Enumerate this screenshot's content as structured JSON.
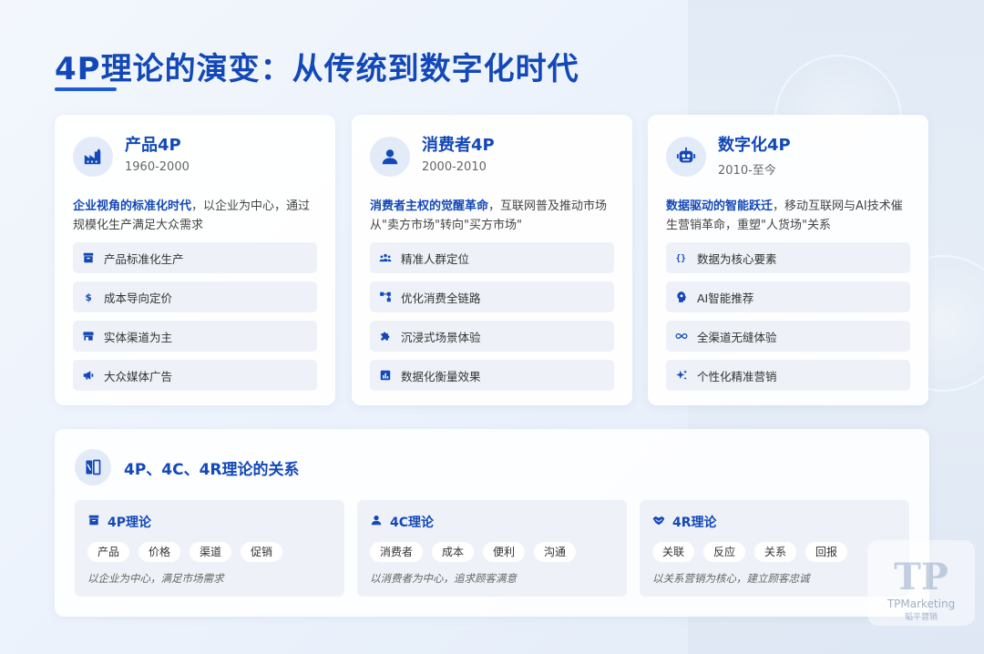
{
  "page": {
    "title": "4P理论的演变：从传统到数字化时代"
  },
  "cards": [
    {
      "title": "产品4P",
      "years": "1960-2000",
      "icon": "factory-icon",
      "desc_highlight": "企业视角的标准化时代",
      "desc_rest": "，以企业为中心，通过规模化生产满足大众需求",
      "features": [
        {
          "icon": "archive-icon",
          "label": "产品标准化生产"
        },
        {
          "icon": "dollar-icon",
          "label": "成本导向定价"
        },
        {
          "icon": "store-icon",
          "label": "实体渠道为主"
        },
        {
          "icon": "megaphone-icon",
          "label": "大众媒体广告"
        }
      ]
    },
    {
      "title": "消费者4P",
      "years": "2000-2010",
      "icon": "person-icon",
      "desc_highlight": "消费者主权的觉醒革命",
      "desc_rest": "，互联网普及推动市场从\"卖方市场\"转向\"买方市场\"",
      "features": [
        {
          "icon": "people-group-icon",
          "label": "精准人群定位"
        },
        {
          "icon": "flow-icon",
          "label": "优化消费全链路"
        },
        {
          "icon": "puzzle-icon",
          "label": "沉浸式场景体验"
        },
        {
          "icon": "bar-chart-icon",
          "label": "数据化衡量效果"
        }
      ]
    },
    {
      "title": "数字化4P",
      "years": "2010-至今",
      "icon": "robot-icon",
      "desc_highlight": "数据驱动的智能跃迁",
      "desc_rest": "，移动互联网与AI技术催生营销革命，重塑\"人货场\"关系",
      "features": [
        {
          "icon": "braces-icon",
          "label": "数据为核心要素"
        },
        {
          "icon": "brain-icon",
          "label": "AI智能推荐"
        },
        {
          "icon": "infinity-icon",
          "label": "全渠道无缝体验"
        },
        {
          "icon": "sparkle-icon",
          "label": "个性化精准营销"
        }
      ]
    }
  ],
  "relation": {
    "title": "4P、4C、4R理论的关系",
    "icon": "book-columns-icon",
    "items": [
      {
        "icon": "archive-icon",
        "title": "4P理论",
        "tags": [
          "产品",
          "价格",
          "渠道",
          "促销"
        ],
        "note": "以企业为中心，满足市场需求"
      },
      {
        "icon": "person-icon",
        "title": "4C理论",
        "tags": [
          "消费者",
          "成本",
          "便利",
          "沟通"
        ],
        "note": "以消费者为中心，追求顾客满意"
      },
      {
        "icon": "handshake-icon",
        "title": "4R理论",
        "tags": [
          "关联",
          "反应",
          "关系",
          "回报"
        ],
        "note": "以关系营销为核心，建立顾客忠诚"
      }
    ]
  },
  "logo": {
    "mark": "TP",
    "brand": "TPMarketing",
    "cn": "韬平营销"
  },
  "colors": {
    "primary": "#1348b8",
    "accent": "#1e5bd6"
  }
}
